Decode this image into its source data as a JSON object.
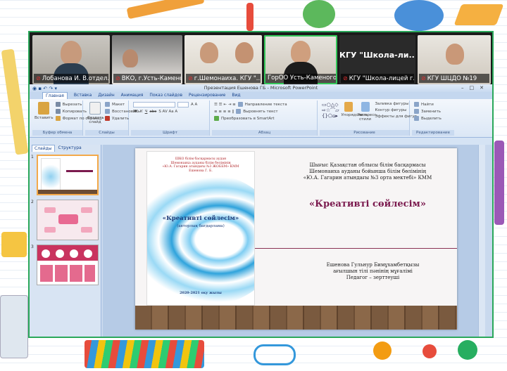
{
  "video": {
    "tiles": [
      {
        "name": "Лобанова И. В.отдел..."
      },
      {
        "name": "ВКО, г.Усть-Каменог..."
      },
      {
        "name": "г.Шемонаиха. КГУ \"..."
      },
      {
        "name": "ГорОО Усть-Каменогор..."
      },
      {
        "name": "КГУ \"Школа-лицей г...",
        "big": "КГУ \"Школа-ли..."
      },
      {
        "name": "КГУ ШЦДО №19"
      }
    ]
  },
  "ppt": {
    "title": "Презентация Ешенова ГБ - Microsoft PowerPoint",
    "tabs": [
      "Главная",
      "Вставка",
      "Дизайн",
      "Анимация",
      "Показ слайдов",
      "Рецензирование",
      "Вид"
    ],
    "groups": [
      "Буфер обмена",
      "Слайды",
      "Шрифт",
      "Абзац",
      "Рисование",
      "Редактирование"
    ],
    "ribbon": {
      "paste": "Вставить",
      "cut": "Вырезать",
      "copy": "Копировать",
      "format_painter": "Формат по образцу",
      "create_slide": "Создать слайд",
      "layout": "Макет",
      "restore": "Восстановить",
      "delete": "Удалить",
      "text_direction": "Направление текста",
      "align_text": "Выровнять текст",
      "smartart": "Преобразовать в SmartArt",
      "arrange": "Упорядочить",
      "quick_styles": "Экспресс-стили",
      "shape_fill": "Заливка фигуры",
      "shape_outline": "Контур фигуры",
      "shape_effects": "Эффекты для фигур",
      "find": "Найти",
      "replace": "Заменить",
      "select": "Выделить"
    },
    "panel_tabs": [
      "Слайды",
      "Структура"
    ]
  },
  "slide": {
    "org_lines": [
      "Шығыс Қазақстан облысы білім басқармасы",
      "Шемонаиха ауданы бойынша білім бөлімінің",
      "«Ю.А. Гагарин атындағы №3 орта мектебі» КММ"
    ],
    "title": "«Креативті сөйлесім»",
    "author_lines": [
      "Ешенова Гульнур Бимұхамбетқызы",
      "ағылшын тілі пәнінің мұғалімі",
      "Педагог – зерттеуші"
    ],
    "cover": {
      "top_lines": [
        "ШКО білім басқармасы аудан",
        "Шемонаиха ауданы білім бөлімінің",
        "«Ю.А. Гагарин атындағы №3 ЖОББМ» КММ",
        "Ешенова Г. Б."
      ],
      "title": "«Креативті сөйлесім»",
      "subtitle": "(авторлық бағдарлама)",
      "foot": "2020-2021 оқу жылы"
    }
  },
  "colors": {
    "active_tile": "#34c759",
    "slide_title": "#7b1a4e",
    "selection": "#f3a94a"
  }
}
